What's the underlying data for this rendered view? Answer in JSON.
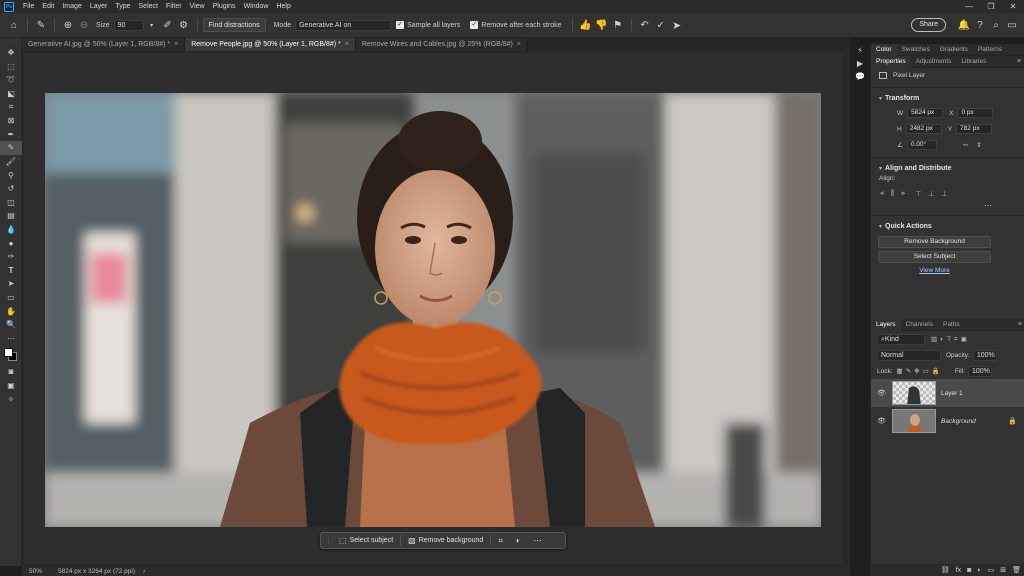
{
  "app": {
    "logo": "Ps"
  },
  "menu": [
    "File",
    "Edit",
    "Image",
    "Layer",
    "Type",
    "Select",
    "Filter",
    "View",
    "Plugins",
    "Window",
    "Help"
  ],
  "window_controls": [
    "—",
    "❐",
    "✕"
  ],
  "options": {
    "size_label": "Size",
    "size_value": "90",
    "find_distractions": "Find distractions",
    "mode_label": "Mode",
    "mode_value": "Generative AI on",
    "sample_all_layers": "Sample all layers",
    "remove_after_stroke": "Remove after each stroke",
    "share": "Share"
  },
  "tabs": [
    {
      "label": "Generative AI.jpg @ 50% (Layer 1, RGB/8#) *",
      "active": false
    },
    {
      "label": "Remove People.jpg @ 50% (Layer 1, RGB/8#) *",
      "active": true
    },
    {
      "label": "Remove Wires and Cables.jpg @ 25% (RGB/8#)",
      "active": false
    }
  ],
  "contextual_taskbar": {
    "select_subject": "Select subject",
    "remove_background": "Remove background"
  },
  "status": {
    "zoom": "50%",
    "doc_info": "5824 px x 3264 px (72 ppi)"
  },
  "panels": {
    "top_tabs": [
      "Color",
      "Swatches",
      "Gradients",
      "Patterns"
    ],
    "second_tabs": [
      "Properties",
      "Adjustments",
      "Libraries"
    ],
    "pixel_layer": "Pixel Layer",
    "transform": {
      "title": "Transform",
      "w_label": "W",
      "w_value": "5824 px",
      "x_label": "X",
      "x_value": "0 px",
      "h_label": "H",
      "h_value": "2482 px",
      "y_label": "Y",
      "y_value": "782 px",
      "angle_value": "0.00°"
    },
    "align": {
      "title": "Align and Distribute",
      "align_label": "Align:"
    },
    "quick_actions": {
      "title": "Quick Actions",
      "remove_background": "Remove Background",
      "select_subject": "Select Subject",
      "view_more": "View More"
    },
    "layers": {
      "tabs": [
        "Layers",
        "Channels",
        "Paths"
      ],
      "kind": "Kind",
      "blend_mode": "Normal",
      "opacity_label": "Opacity:",
      "opacity_value": "100%",
      "lock_label": "Lock:",
      "fill_label": "Fill:",
      "fill_value": "100%",
      "items": [
        {
          "name": "Layer 1",
          "selected": true
        },
        {
          "name": "Background",
          "selected": false
        }
      ]
    }
  }
}
